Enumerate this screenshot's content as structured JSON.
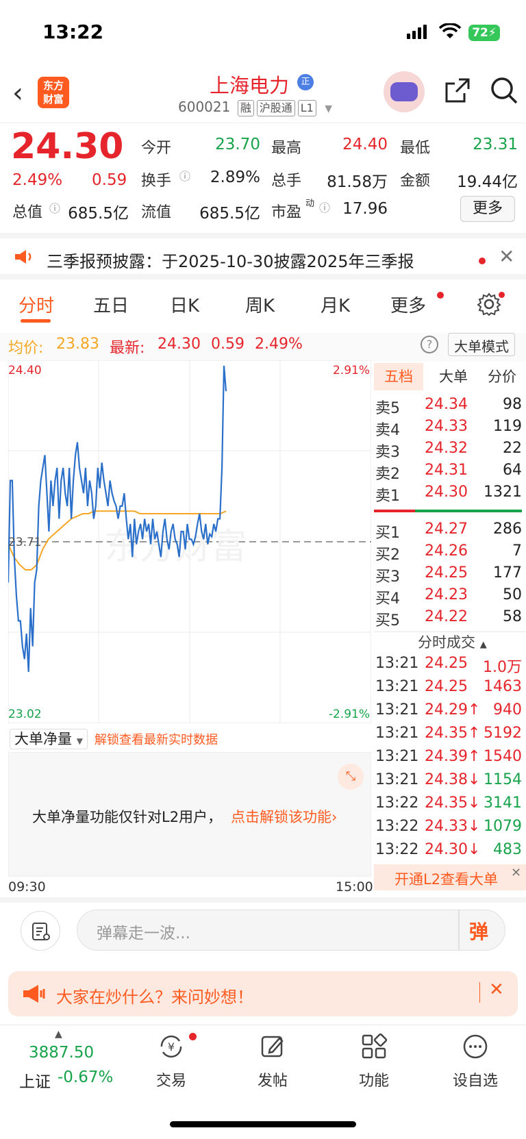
{
  "status": {
    "time": "13:22",
    "battery": "72"
  },
  "header": {
    "logo_line1": "东方",
    "logo_line2": "财富",
    "stock_name": "上海电力",
    "stock_badge": "正",
    "stock_code": "600021",
    "tags": [
      "融",
      "沪股通",
      "L1"
    ]
  },
  "quote": {
    "price": "24.30",
    "change_pct": "2.49%",
    "change": "0.59",
    "items": [
      {
        "label": "今开",
        "value": "23.70",
        "color": "green"
      },
      {
        "label": "最高",
        "value": "24.40",
        "color": "red"
      },
      {
        "label": "最低",
        "value": "23.31",
        "color": "green"
      },
      {
        "label": "换手",
        "value": "2.89%",
        "color": "black"
      },
      {
        "label": "总手",
        "value": "81.58万",
        "color": "black"
      },
      {
        "label": "金额",
        "value": "19.44亿",
        "color": "black"
      },
      {
        "label": "流值",
        "value": "685.5亿",
        "color": "black"
      },
      {
        "label": "市盈",
        "value": "17.96",
        "color": "black"
      }
    ],
    "total_value_label": "总值",
    "total_value": "685.5亿",
    "pe_super": "动",
    "more_label": "更多"
  },
  "notice": {
    "text": "三季报预披露：于2025-10-30披露2025年三季报"
  },
  "tabs": [
    "分时",
    "五日",
    "日K",
    "周K",
    "月K",
    "更多"
  ],
  "infoline": {
    "avg_label": "均价:",
    "avg_value": "23.83",
    "latest_label": "最新:",
    "latest_value": "24.30",
    "latest_change": "0.59",
    "latest_pct": "2.49%",
    "mode_label": "大单模式"
  },
  "chart_data": {
    "type": "line",
    "y_axis_left": {
      "top": "24.40",
      "mid": "23.71",
      "bottom": "23.02"
    },
    "y_axis_right": {
      "top": "2.91%",
      "bottom": "-2.91%"
    },
    "ylim": [
      23.02,
      24.4
    ],
    "prev_close": 23.71,
    "x_labels": {
      "start": "09:30",
      "end": "15:00"
    },
    "watermark": "东方财富",
    "series": [
      {
        "name": "price",
        "color": "#2a6fc9",
        "values": [
          23.55,
          23.95,
          23.95,
          23.65,
          23.5,
          23.4,
          23.4,
          23.3,
          23.25,
          23.35,
          23.2,
          23.45,
          23.3,
          23.55,
          23.6,
          23.85,
          23.95,
          24.0,
          24.05,
          23.9,
          23.75,
          23.95,
          23.85,
          23.95,
          24.0,
          23.8,
          23.95,
          24.0,
          23.9,
          23.85,
          24.0,
          23.8,
          23.95,
          24.05,
          24.1,
          24.0,
          23.95,
          23.9,
          24.0,
          23.85,
          23.95,
          23.9,
          23.8,
          23.85,
          24.0,
          23.92,
          24.02,
          23.95,
          23.9,
          23.85,
          23.95,
          23.9,
          23.87,
          23.85,
          23.8,
          23.85,
          23.85,
          23.9,
          23.8,
          23.72,
          23.78,
          23.65,
          23.8,
          23.7,
          23.75,
          23.78,
          23.72,
          23.8,
          23.75,
          23.78,
          23.7,
          23.8,
          23.72,
          23.75,
          23.7,
          23.65,
          23.75,
          23.8,
          23.72,
          23.68,
          23.75,
          23.78,
          23.72,
          23.7,
          23.65,
          23.75,
          23.75,
          23.68,
          23.78,
          23.72,
          23.72,
          23.7,
          23.73,
          23.78,
          23.82,
          23.75,
          23.72,
          23.78,
          23.7,
          23.74,
          23.73,
          23.78,
          23.75,
          23.8,
          23.8,
          24.0,
          24.4,
          24.3
        ]
      },
      {
        "name": "avg",
        "color": "#f5a623",
        "values": [
          23.7,
          23.65,
          23.62,
          23.6,
          23.6,
          23.62,
          23.68,
          23.72,
          23.74,
          23.76,
          23.78,
          23.8,
          23.81,
          23.82,
          23.82,
          23.83,
          23.83,
          23.83,
          23.83,
          23.83,
          23.83,
          23.83,
          23.83,
          23.82,
          23.82,
          23.82,
          23.82,
          23.82,
          23.82,
          23.82,
          23.82,
          23.82,
          23.82,
          23.82,
          23.82,
          23.82,
          23.82,
          23.82,
          23.83
        ]
      }
    ]
  },
  "orderbook": {
    "tabs": [
      "五档",
      "大单",
      "分价"
    ],
    "asks": [
      {
        "label": "卖5",
        "price": "24.34",
        "vol": "98"
      },
      {
        "label": "卖4",
        "price": "24.33",
        "vol": "119"
      },
      {
        "label": "卖3",
        "price": "24.32",
        "vol": "22"
      },
      {
        "label": "卖2",
        "price": "24.31",
        "vol": "64"
      },
      {
        "label": "卖1",
        "price": "24.30",
        "vol": "1321"
      }
    ],
    "bids": [
      {
        "label": "买1",
        "price": "24.27",
        "vol": "286"
      },
      {
        "label": "买2",
        "price": "24.26",
        "vol": "7"
      },
      {
        "label": "买3",
        "price": "24.25",
        "vol": "177"
      },
      {
        "label": "买4",
        "price": "24.23",
        "vol": "50"
      },
      {
        "label": "买5",
        "price": "24.22",
        "vol": "58"
      }
    ],
    "ticks_title": "分时成交",
    "ticks": [
      {
        "time": "13:21",
        "price": "24.25",
        "vol": "1.0万",
        "dir": "",
        "color": "red"
      },
      {
        "time": "13:21",
        "price": "24.25",
        "vol": "1463",
        "dir": "",
        "color": "red"
      },
      {
        "time": "13:21",
        "price": "24.29↑",
        "vol": "940",
        "dir": "up",
        "color": "red"
      },
      {
        "time": "13:21",
        "price": "24.35↑",
        "vol": "5192",
        "dir": "up",
        "color": "red"
      },
      {
        "time": "13:21",
        "price": "24.39↑",
        "vol": "1540",
        "dir": "up",
        "color": "red"
      },
      {
        "time": "13:21",
        "price": "24.38↓",
        "vol": "1154",
        "dir": "down",
        "color": "green"
      },
      {
        "time": "13:22",
        "price": "24.35↓",
        "vol": "3141",
        "dir": "down",
        "color": "green"
      },
      {
        "time": "13:22",
        "price": "24.33↓",
        "vol": "1079",
        "dir": "down",
        "color": "green"
      },
      {
        "time": "13:22",
        "price": "24.30↓",
        "vol": "483",
        "dir": "down",
        "color": "green"
      }
    ],
    "l2_banner": "开通L2查看大单"
  },
  "bigorder": {
    "dropdown": "大单净量",
    "unlock_link": "解锁查看最新实时数据",
    "msg": "大单净量功能仅针对L2用户，",
    "msg_link": "点击解锁该功能"
  },
  "danmu": {
    "placeholder": "弹幕走一波...",
    "send": "弹"
  },
  "promo": {
    "text": "大家在炒什么？来问妙想！"
  },
  "tabbar": {
    "index_value": "3887.50",
    "index_name": "上证",
    "index_change": "-0.67%",
    "items": [
      "交易",
      "发帖",
      "功能",
      "设自选"
    ]
  }
}
